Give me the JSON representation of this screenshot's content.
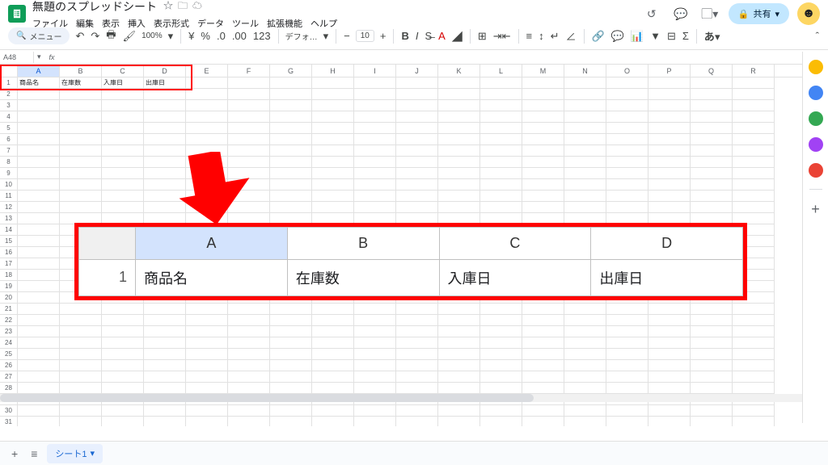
{
  "header": {
    "doc_title": "無題のスプレッドシート",
    "menus": [
      "ファイル",
      "編集",
      "表示",
      "挿入",
      "表示形式",
      "データ",
      "ツール",
      "拡張機能",
      "ヘルプ"
    ],
    "share_label": "共有"
  },
  "toolbar": {
    "search_label": "メニュー",
    "zoom": "100%",
    "font": "デフォ…",
    "font_size": "10"
  },
  "namebox": "A48",
  "columns": [
    "A",
    "B",
    "C",
    "D",
    "E",
    "F",
    "G",
    "H",
    "I",
    "J",
    "K",
    "L",
    "M",
    "N",
    "O",
    "P",
    "Q",
    "R"
  ],
  "selected_col": "A",
  "row_count": 34,
  "row1": {
    "A": "商品名",
    "B": "在庫数",
    "C": "入庫日",
    "D": "出庫日"
  },
  "callout": {
    "cols": [
      "A",
      "B",
      "C",
      "D"
    ],
    "row_num": "1",
    "cells": [
      "商品名",
      "在庫数",
      "入庫日",
      "出庫日"
    ]
  },
  "sheet_tab": "シート1",
  "right_panel_colors": [
    "#fbbc04",
    "#4285f4",
    "#34a853",
    "#a142f4",
    "#ea4335",
    "#fbbc04"
  ]
}
